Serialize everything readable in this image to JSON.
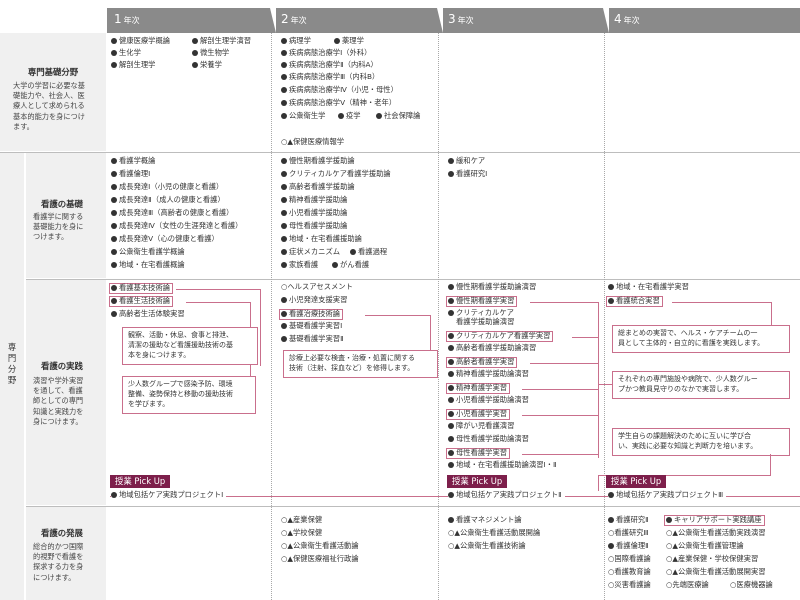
{
  "years": [
    {
      "num": "1",
      "unit": "年次"
    },
    {
      "num": "2",
      "unit": "年次"
    },
    {
      "num": "3",
      "unit": "年次"
    },
    {
      "num": "4",
      "unit": "年次"
    }
  ],
  "sections": {
    "kiso": {
      "title": "専門基礎分野",
      "desc": "大学の学習に必要な基\n礎能力や、社会人、医\n療人として求められる\n基本的能力を身につけ\nます。"
    },
    "senmon_label": "専\n門\n分\n野",
    "kango_kiso": {
      "title": "看護の基礎",
      "desc": "看護学に関する\n基礎能力を身に\nつけます。"
    },
    "kango_jissen": {
      "title": "看護の実践",
      "desc": "演習や学外実習\nを通して、看護\n師としての専門\n知識と実践力を\n身につけます。"
    },
    "kango_hatten": {
      "title": "看護の発展",
      "desc": "総合的かつ国際\n的視野で看護を\n探求する力を身\nにつけます。"
    }
  },
  "kiso_courses": {
    "y1": [
      "健康医療学概論",
      "解剖生理学演習",
      "生化学",
      "微生物学",
      "解剖生理学",
      "栄養学"
    ],
    "y2": [
      "病理学",
      "薬理学",
      "疾病病態治療学Ⅰ（外科）",
      "疾病病態治療学Ⅱ（内科A）",
      "疾病病態治療学Ⅲ（内科B）",
      "疾病病態治療学Ⅳ（小児・母性）",
      "疾病病態治療学Ⅴ（精神・老年）",
      "公衆衛生学",
      "疫学",
      "社会保障論",
      "保健医療情報学"
    ],
    "y2_last_mark": "○▲"
  },
  "kango_kiso_courses": {
    "y1": [
      "看護学概論",
      "看護倫理Ⅰ",
      "成長発達Ⅰ（小児の健康と看護）",
      "成長発達Ⅱ（成人の健康と看護）",
      "成長発達Ⅲ（高齢者の健康と看護）",
      "成長発達Ⅳ（女性の生涯発達と看護）",
      "成長発達Ⅴ（心の健康と看護）",
      "公衆衛生看護学概論",
      "地域・在宅看護概論"
    ],
    "y2": [
      "慢性期看護学援助論",
      "クリティカルケア看護学援助論",
      "高齢者看護学援助論",
      "精神看護学援助論",
      "小児看護学援助論",
      "母性看護学援助論",
      "地域・在宅看護援助論",
      "症状メカニズム",
      "看護過程",
      "家族看護",
      "がん看護"
    ],
    "y3": [
      "緩和ケア",
      "看護研究Ⅰ"
    ]
  },
  "jissen_courses": {
    "y1": [
      "看護基本技術論",
      "看護生活技術論",
      "高齢者生活体験実習"
    ],
    "y2": [
      "ヘルスアセスメント",
      "小児発達支援実習",
      "看護治療技術論",
      "基礎看護学実習Ⅰ",
      "基礎看護学実習Ⅱ"
    ],
    "y3": [
      "慢性期看護学援助論演習",
      "慢性期看護学実習",
      "クリティカルケア",
      "看護学援助論演習",
      "クリティカルケア看護学実習",
      "高齢者看護学援助論演習",
      "高齢者看護学実習",
      "精神看護学援助論演習",
      "精神看護学実習",
      "小児看護学援助論演習",
      "小児看護学実習",
      "障がい児看護演習",
      "母性看護学援助論演習",
      "母性看護学実習",
      "地域・在宅看護援助論演習Ⅰ・Ⅱ"
    ],
    "y4": [
      "地域・在宅看護学実習",
      "看護統合実習"
    ]
  },
  "notes": {
    "n1": "観察、活動・休息、食事と排泄、\n清潔の援助など看護援助技術の基\n本を身につけます。",
    "n2": "少人数グループで感染予防、環境\n整備、姿勢保持と移動の援助技術\nを学びます。",
    "n3": "診療上必要な検査・治療・処置に関する\n技術（注射、採血など）を修得します。",
    "n4": "総まとめの実習で、ヘルス・ケアチームの一\n員として主体的・自立的に看護を実践します。",
    "n5": "それぞれの専門施設や病院で、少人数グルー\nプかつ教員見守りのなかで実習します。",
    "n6": "学生自らの課題解決のために互いに学び合\nい、実践に必要な知識と判断力を培います。"
  },
  "pickup": {
    "label": "授業 Pick Up",
    "p1": "地域包括ケア実践プロジェクトⅠ",
    "p2": "地域包括ケア実践プロジェクトⅡ",
    "p3": "地域包括ケア実践プロジェクトⅢ"
  },
  "hatten_courses": {
    "y2": [
      "産業保健",
      "学校保健",
      "公衆衛生看護活動論",
      "保健医療福祉行政論"
    ],
    "y3": [
      "看護マネジメント論",
      "公衆衛生看護活動展開論",
      "公衆衛生看護技術論"
    ],
    "y4a": [
      "看護研究Ⅱ",
      "看護研究Ⅲ",
      "看護倫理Ⅱ",
      "国際看護論",
      "看護教育論",
      "災害看護論"
    ],
    "y4b": [
      "キャリアサポート実践講座",
      "公衆衛生看護活動実践演習",
      "公衆衛生看護管理論",
      "産業保健・学校保健実習",
      "公衆衛生看護活動展開実習",
      "先端医療論",
      "医療機器論"
    ],
    "mark_op": "○▲",
    "mark_o": "○"
  },
  "colors": {
    "header": "#8a8a8a",
    "accent": "#c96f8c",
    "pickup": "#7d1f4b",
    "label_bg": "#f0f0f0"
  }
}
